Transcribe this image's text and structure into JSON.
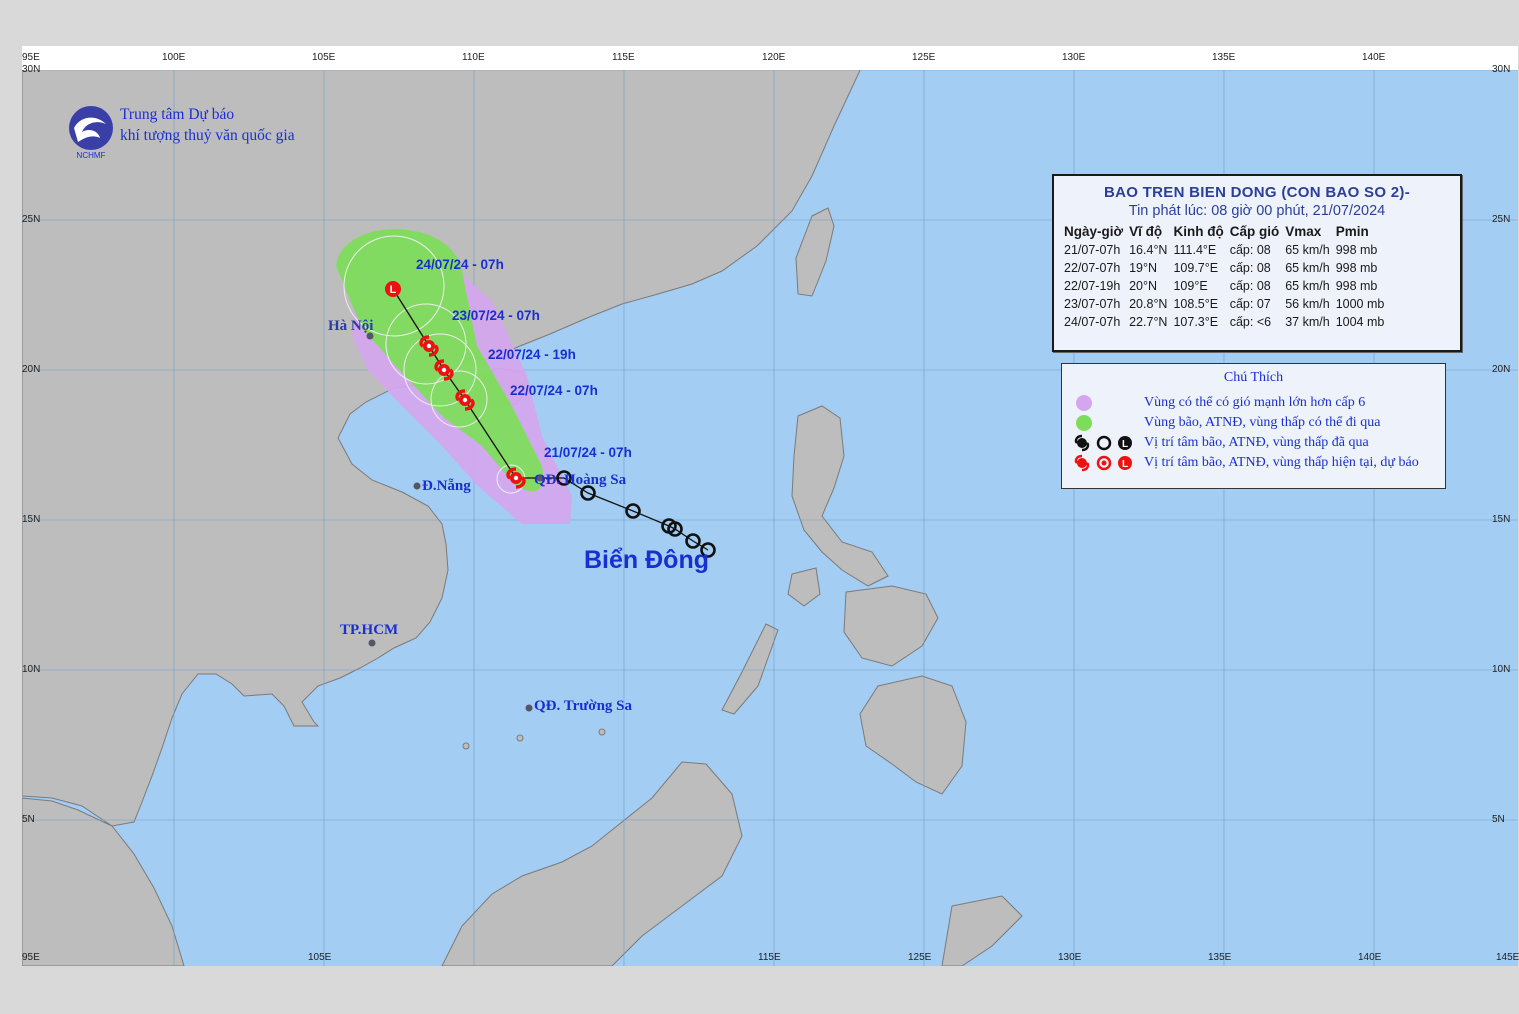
{
  "agency": {
    "name_line1": "Trung tâm Dự báo",
    "name_line2": "khí tượng thuỷ văn quốc gia",
    "logo_text": "NCHMF"
  },
  "axes": {
    "longitude_ticks_top": [
      "95E",
      "100E",
      "105E",
      "110E",
      "115E",
      "120E",
      "125E",
      "130E",
      "135E",
      "140E"
    ],
    "longitude_ticks_bottom": [
      "95E",
      "105E",
      "115E",
      "125E",
      "130E",
      "135E",
      "140E",
      "145E"
    ],
    "latitude_ticks": [
      "30N",
      "25N",
      "20N",
      "15N",
      "10N",
      "5N"
    ]
  },
  "places": {
    "hanoi": "Hà Nội",
    "danang": "Đ.Nẵng",
    "hcm": "TP.HCM",
    "hoangsa": "QĐ. Hoàng Sa",
    "truongsa": "QĐ. Trường Sa",
    "sea": "Biển Đông"
  },
  "track_labels": {
    "t0": "21/07/24 - 07h",
    "t1": "22/07/24 - 07h",
    "t2": "22/07/24 - 19h",
    "t3": "23/07/24 - 07h",
    "t4": "24/07/24 - 07h"
  },
  "info": {
    "title": "BAO TREN BIEN DONG (CON BAO SO 2)-",
    "issued": "Tin phát lúc: 08 giờ 00 phút, 21/07/2024",
    "headers": [
      "Ngày-giờ",
      "Vĩ độ",
      "Kinh độ",
      "Cấp gió",
      "Vmax",
      "Pmin"
    ],
    "rows": [
      [
        "21/07-07h",
        "16.4°N",
        "111.4°E",
        "cấp: 08",
        "65 km/h",
        "998 mb"
      ],
      [
        "22/07-07h",
        "19°N",
        "109.7°E",
        "cấp: 08",
        "65 km/h",
        "998 mb"
      ],
      [
        "22/07-19h",
        "20°N",
        "109°E",
        "cấp: 08",
        "65 km/h",
        "998 mb"
      ],
      [
        "23/07-07h",
        "20.8°N",
        "108.5°E",
        "cấp: 07",
        "56 km/h",
        "1000 mb"
      ],
      [
        "24/07-07h",
        "22.7°N",
        "107.3°E",
        "cấp: <6",
        "37 km/h",
        "1004 mb"
      ]
    ]
  },
  "legend": {
    "title": "Chú Thích",
    "items": [
      "Vùng có thể có gió mạnh lớn hơn cấp 6",
      "Vùng bão, ATNĐ, vùng thấp có thể đi qua",
      "Vị trí tâm bão, ATNĐ, vùng thấp đã qua",
      "Vị trí tâm bão, ATNĐ, vùng thấp hiện tại, dự báo"
    ],
    "low_symbol": "L"
  },
  "colors": {
    "sea": "#a3cdf3",
    "land": "#bdbdbd",
    "wind_zone": "#d5a6ef",
    "track_zone": "#7edc5c",
    "storm_red": "#ee1111",
    "label_blue": "#1b2fd1"
  },
  "past_track": [
    {
      "lat": 16.4,
      "lon": 113.0
    },
    {
      "lat": 15.9,
      "lon": 113.8
    },
    {
      "lat": 15.3,
      "lon": 115.3
    },
    {
      "lat": 14.8,
      "lon": 116.5
    },
    {
      "lat": 14.7,
      "lon": 116.7
    },
    {
      "lat": 14.3,
      "lon": 117.3
    },
    {
      "lat": 14.0,
      "lon": 117.8
    }
  ],
  "forecast_track": [
    {
      "lat": 16.4,
      "lon": 111.4,
      "type": "storm"
    },
    {
      "lat": 19.0,
      "lon": 109.7,
      "type": "storm"
    },
    {
      "lat": 20.0,
      "lon": 109.0,
      "type": "storm"
    },
    {
      "lat": 20.8,
      "lon": 108.5,
      "type": "storm"
    },
    {
      "lat": 22.7,
      "lon": 107.3,
      "type": "low"
    }
  ]
}
